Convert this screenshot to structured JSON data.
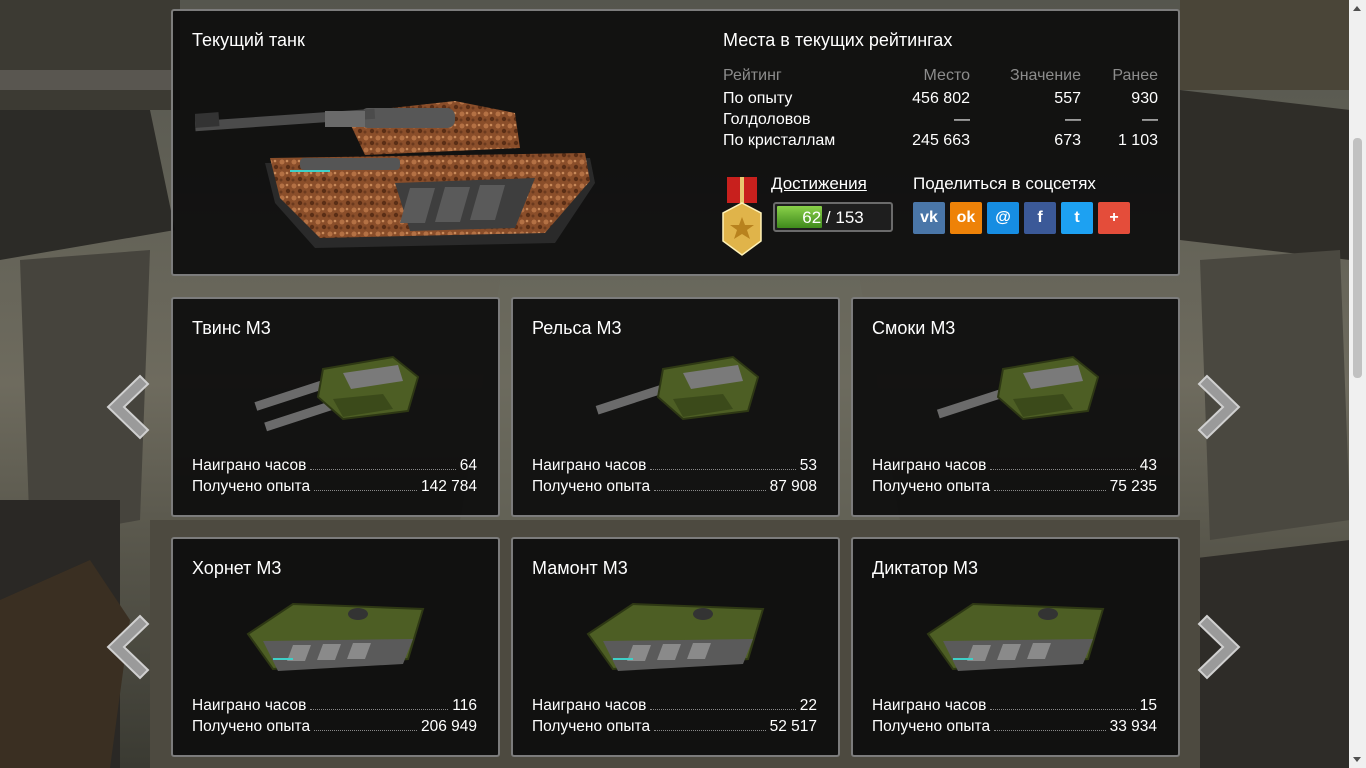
{
  "current_tank": {
    "title": "Текущий танк"
  },
  "ratings": {
    "title": "Места в текущих рейтингах",
    "headers": [
      "Рейтинг",
      "Место",
      "Значение",
      "Ранее"
    ],
    "rows": [
      [
        "По опыту",
        "456 802",
        "557",
        "930"
      ],
      [
        "Голдоловов",
        "—",
        "—",
        "—"
      ],
      [
        "По кристаллам",
        "245 663",
        "673",
        "1 103"
      ]
    ]
  },
  "achievements": {
    "link_label": "Достижения",
    "earned": "62",
    "separator": "/",
    "total": "153",
    "progress_fraction": 0.405
  },
  "share": {
    "title": "Поделиться в соцсетях",
    "networks": [
      {
        "icon": "vk-icon",
        "glyph": "vk",
        "color": "#4a76a8"
      },
      {
        "icon": "odnoklassniki-icon",
        "glyph": "ok",
        "color": "#ee8208"
      },
      {
        "icon": "mail-icon",
        "glyph": "@",
        "color": "#168de2"
      },
      {
        "icon": "facebook-icon",
        "glyph": "f",
        "color": "#3b5998"
      },
      {
        "icon": "twitter-icon",
        "glyph": "t",
        "color": "#1da1f2"
      },
      {
        "icon": "more-share-icon",
        "glyph": "+",
        "color": "#e44d3a"
      }
    ]
  },
  "stat_labels": {
    "hours": "Наиграно часов",
    "xp": "Получено опыта"
  },
  "cards": [
    {
      "name": "Твинс M3",
      "kind": "turret",
      "hours": "64",
      "xp": "142 784"
    },
    {
      "name": "Рельса M3",
      "kind": "turret",
      "hours": "53",
      "xp": "87 908"
    },
    {
      "name": "Смоки M3",
      "kind": "turret",
      "hours": "43",
      "xp": "75 235"
    },
    {
      "name": "Хорнет M3",
      "kind": "hull",
      "hours": "116",
      "xp": "206 949"
    },
    {
      "name": "Мамонт M3",
      "kind": "hull",
      "hours": "22",
      "xp": "52 517"
    },
    {
      "name": "Диктатор M3",
      "kind": "hull",
      "hours": "15",
      "xp": "33 934"
    }
  ],
  "colors": {
    "panel_border": "#7c7c7c",
    "progress_green": "#6cba34",
    "camo_green": "#4d5e24",
    "tank_copper": "#8a4e2a"
  }
}
